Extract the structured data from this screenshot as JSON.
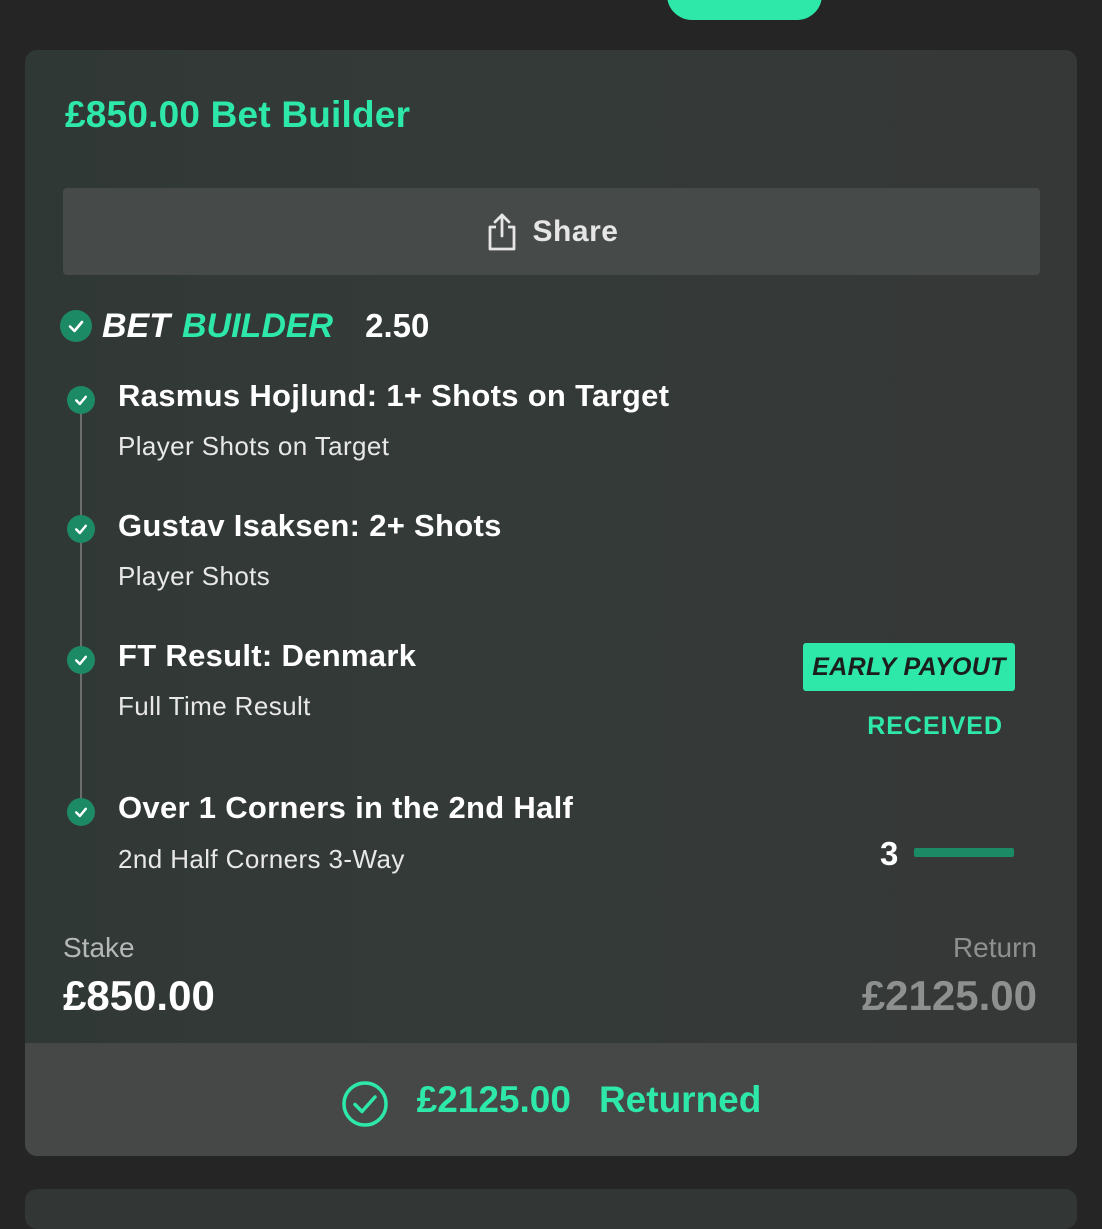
{
  "header": {
    "title": "£850.00 Bet Builder",
    "share_label": "Share"
  },
  "bet_builder": {
    "label_part1": "BET",
    "label_part2": "BUILDER",
    "odds": "2.50"
  },
  "legs": [
    {
      "title": "Rasmus Hojlund: 1+ Shots on Target",
      "subtitle": "Player Shots on Target"
    },
    {
      "title": "Gustav Isaksen: 2+ Shots",
      "subtitle": "Player Shots"
    },
    {
      "title": "FT Result: Denmark",
      "subtitle": "Full Time Result"
    },
    {
      "title": "Over 1 Corners in the 2nd Half",
      "subtitle": "2nd Half Corners 3-Way"
    }
  ],
  "early_payout": {
    "badge": "EARLY PAYOUT",
    "status": "RECEIVED"
  },
  "corners_progress": {
    "value": "3",
    "fill_fraction": 1.0
  },
  "summary": {
    "stake_label": "Stake",
    "stake_value": "£850.00",
    "return_label": "Return",
    "return_value": "£2125.00"
  },
  "result": {
    "amount": "£2125.00",
    "label": "Returned"
  },
  "colors": {
    "accent": "#2de8a9",
    "check_green": "#1d8a66",
    "background": "#252525"
  },
  "icons": {
    "share": "share-icon",
    "check": "check-circle-icon"
  }
}
